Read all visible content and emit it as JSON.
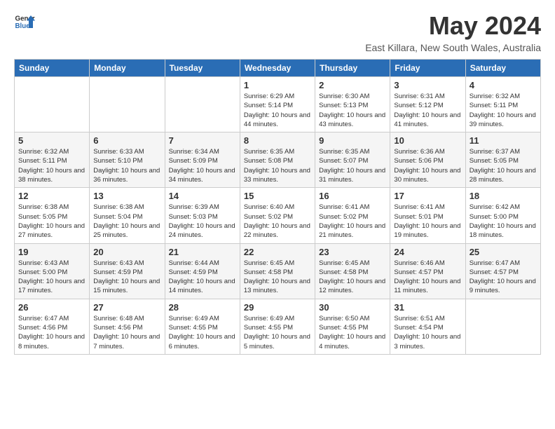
{
  "header": {
    "logo_general": "General",
    "logo_blue": "Blue",
    "month": "May 2024",
    "location": "East Killara, New South Wales, Australia"
  },
  "columns": [
    "Sunday",
    "Monday",
    "Tuesday",
    "Wednesday",
    "Thursday",
    "Friday",
    "Saturday"
  ],
  "weeks": [
    [
      {
        "day": "",
        "sunrise": "",
        "sunset": "",
        "daylight": ""
      },
      {
        "day": "",
        "sunrise": "",
        "sunset": "",
        "daylight": ""
      },
      {
        "day": "",
        "sunrise": "",
        "sunset": "",
        "daylight": ""
      },
      {
        "day": "1",
        "sunrise": "Sunrise: 6:29 AM",
        "sunset": "Sunset: 5:14 PM",
        "daylight": "Daylight: 10 hours and 44 minutes."
      },
      {
        "day": "2",
        "sunrise": "Sunrise: 6:30 AM",
        "sunset": "Sunset: 5:13 PM",
        "daylight": "Daylight: 10 hours and 43 minutes."
      },
      {
        "day": "3",
        "sunrise": "Sunrise: 6:31 AM",
        "sunset": "Sunset: 5:12 PM",
        "daylight": "Daylight: 10 hours and 41 minutes."
      },
      {
        "day": "4",
        "sunrise": "Sunrise: 6:32 AM",
        "sunset": "Sunset: 5:11 PM",
        "daylight": "Daylight: 10 hours and 39 minutes."
      }
    ],
    [
      {
        "day": "5",
        "sunrise": "Sunrise: 6:32 AM",
        "sunset": "Sunset: 5:11 PM",
        "daylight": "Daylight: 10 hours and 38 minutes."
      },
      {
        "day": "6",
        "sunrise": "Sunrise: 6:33 AM",
        "sunset": "Sunset: 5:10 PM",
        "daylight": "Daylight: 10 hours and 36 minutes."
      },
      {
        "day": "7",
        "sunrise": "Sunrise: 6:34 AM",
        "sunset": "Sunset: 5:09 PM",
        "daylight": "Daylight: 10 hours and 34 minutes."
      },
      {
        "day": "8",
        "sunrise": "Sunrise: 6:35 AM",
        "sunset": "Sunset: 5:08 PM",
        "daylight": "Daylight: 10 hours and 33 minutes."
      },
      {
        "day": "9",
        "sunrise": "Sunrise: 6:35 AM",
        "sunset": "Sunset: 5:07 PM",
        "daylight": "Daylight: 10 hours and 31 minutes."
      },
      {
        "day": "10",
        "sunrise": "Sunrise: 6:36 AM",
        "sunset": "Sunset: 5:06 PM",
        "daylight": "Daylight: 10 hours and 30 minutes."
      },
      {
        "day": "11",
        "sunrise": "Sunrise: 6:37 AM",
        "sunset": "Sunset: 5:05 PM",
        "daylight": "Daylight: 10 hours and 28 minutes."
      }
    ],
    [
      {
        "day": "12",
        "sunrise": "Sunrise: 6:38 AM",
        "sunset": "Sunset: 5:05 PM",
        "daylight": "Daylight: 10 hours and 27 minutes."
      },
      {
        "day": "13",
        "sunrise": "Sunrise: 6:38 AM",
        "sunset": "Sunset: 5:04 PM",
        "daylight": "Daylight: 10 hours and 25 minutes."
      },
      {
        "day": "14",
        "sunrise": "Sunrise: 6:39 AM",
        "sunset": "Sunset: 5:03 PM",
        "daylight": "Daylight: 10 hours and 24 minutes."
      },
      {
        "day": "15",
        "sunrise": "Sunrise: 6:40 AM",
        "sunset": "Sunset: 5:02 PM",
        "daylight": "Daylight: 10 hours and 22 minutes."
      },
      {
        "day": "16",
        "sunrise": "Sunrise: 6:41 AM",
        "sunset": "Sunset: 5:02 PM",
        "daylight": "Daylight: 10 hours and 21 minutes."
      },
      {
        "day": "17",
        "sunrise": "Sunrise: 6:41 AM",
        "sunset": "Sunset: 5:01 PM",
        "daylight": "Daylight: 10 hours and 19 minutes."
      },
      {
        "day": "18",
        "sunrise": "Sunrise: 6:42 AM",
        "sunset": "Sunset: 5:00 PM",
        "daylight": "Daylight: 10 hours and 18 minutes."
      }
    ],
    [
      {
        "day": "19",
        "sunrise": "Sunrise: 6:43 AM",
        "sunset": "Sunset: 5:00 PM",
        "daylight": "Daylight: 10 hours and 17 minutes."
      },
      {
        "day": "20",
        "sunrise": "Sunrise: 6:43 AM",
        "sunset": "Sunset: 4:59 PM",
        "daylight": "Daylight: 10 hours and 15 minutes."
      },
      {
        "day": "21",
        "sunrise": "Sunrise: 6:44 AM",
        "sunset": "Sunset: 4:59 PM",
        "daylight": "Daylight: 10 hours and 14 minutes."
      },
      {
        "day": "22",
        "sunrise": "Sunrise: 6:45 AM",
        "sunset": "Sunset: 4:58 PM",
        "daylight": "Daylight: 10 hours and 13 minutes."
      },
      {
        "day": "23",
        "sunrise": "Sunrise: 6:45 AM",
        "sunset": "Sunset: 4:58 PM",
        "daylight": "Daylight: 10 hours and 12 minutes."
      },
      {
        "day": "24",
        "sunrise": "Sunrise: 6:46 AM",
        "sunset": "Sunset: 4:57 PM",
        "daylight": "Daylight: 10 hours and 11 minutes."
      },
      {
        "day": "25",
        "sunrise": "Sunrise: 6:47 AM",
        "sunset": "Sunset: 4:57 PM",
        "daylight": "Daylight: 10 hours and 9 minutes."
      }
    ],
    [
      {
        "day": "26",
        "sunrise": "Sunrise: 6:47 AM",
        "sunset": "Sunset: 4:56 PM",
        "daylight": "Daylight: 10 hours and 8 minutes."
      },
      {
        "day": "27",
        "sunrise": "Sunrise: 6:48 AM",
        "sunset": "Sunset: 4:56 PM",
        "daylight": "Daylight: 10 hours and 7 minutes."
      },
      {
        "day": "28",
        "sunrise": "Sunrise: 6:49 AM",
        "sunset": "Sunset: 4:55 PM",
        "daylight": "Daylight: 10 hours and 6 minutes."
      },
      {
        "day": "29",
        "sunrise": "Sunrise: 6:49 AM",
        "sunset": "Sunset: 4:55 PM",
        "daylight": "Daylight: 10 hours and 5 minutes."
      },
      {
        "day": "30",
        "sunrise": "Sunrise: 6:50 AM",
        "sunset": "Sunset: 4:55 PM",
        "daylight": "Daylight: 10 hours and 4 minutes."
      },
      {
        "day": "31",
        "sunrise": "Sunrise: 6:51 AM",
        "sunset": "Sunset: 4:54 PM",
        "daylight": "Daylight: 10 hours and 3 minutes."
      },
      {
        "day": "",
        "sunrise": "",
        "sunset": "",
        "daylight": ""
      }
    ]
  ]
}
